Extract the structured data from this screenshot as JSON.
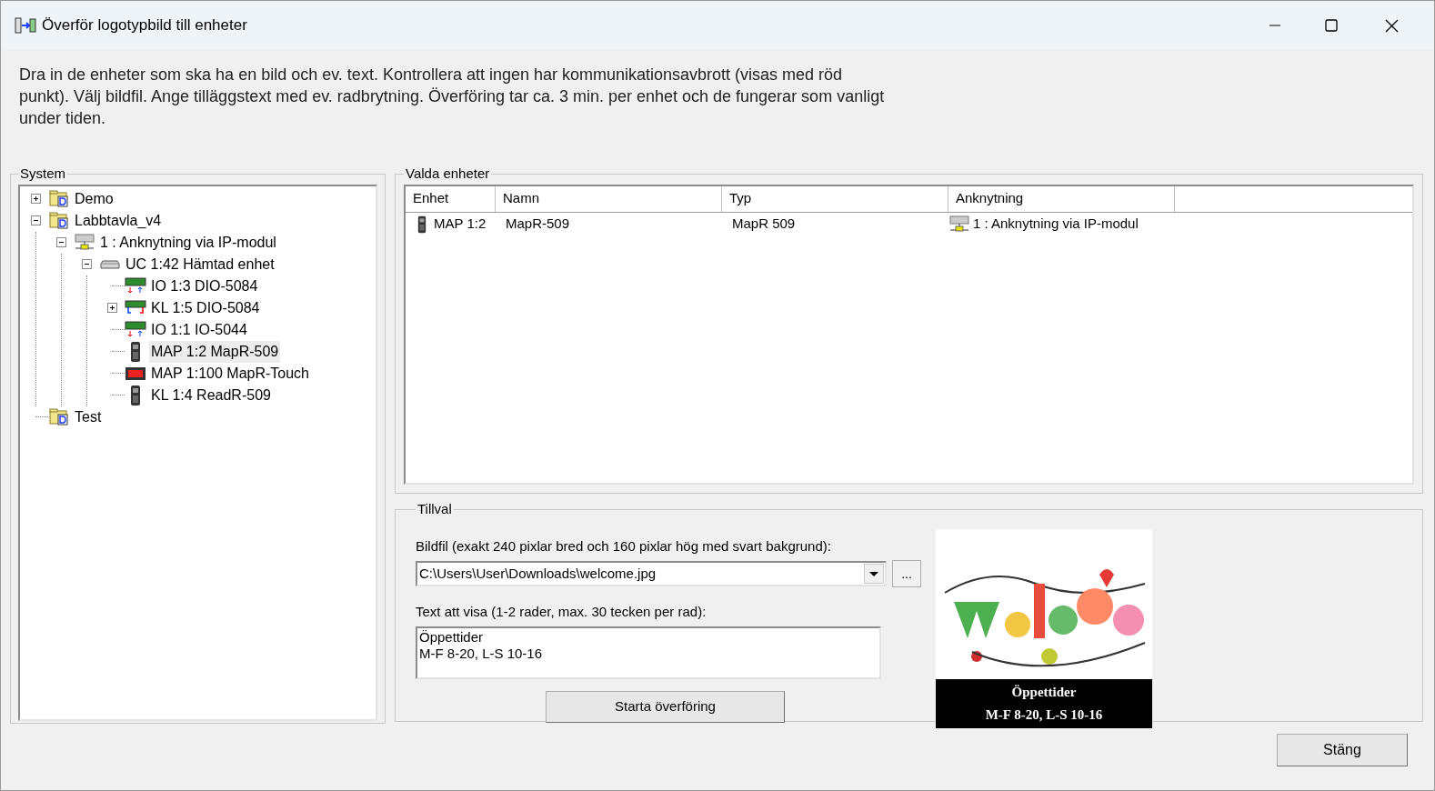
{
  "window": {
    "title": "Överför logotypbild till enheter"
  },
  "instructions": "Dra in de enheter som ska ha en bild och ev. text. Kontrollera att ingen har kommunikationsavbrott (visas med röd punkt). Välj bildfil. Ange tilläggstext med ev. radbrytning. Överföring tar ca. 3 min. per enhet och de fungerar som vanligt under tiden.",
  "system": {
    "title": "System",
    "tree": [
      {
        "label": "Demo",
        "kind": "folder",
        "expanded": false,
        "selected": false
      },
      {
        "label": "Labbtavla_v4",
        "kind": "folder",
        "expanded": true,
        "selected": false,
        "children": [
          {
            "label": "1 : Anknytning via IP-modul",
            "kind": "network",
            "expanded": true,
            "selected": false,
            "children": [
              {
                "label": "UC 1:42 Hämtad enhet",
                "kind": "controller",
                "expanded": true,
                "selected": false,
                "children": [
                  {
                    "label": "IO 1:3 DIO-5084",
                    "kind": "io",
                    "selected": false
                  },
                  {
                    "label": "KL 1:5 DIO-5084",
                    "kind": "kl",
                    "expanded": false,
                    "selected": false
                  },
                  {
                    "label": "IO 1:1 IO-5044",
                    "kind": "io",
                    "selected": false
                  },
                  {
                    "label": "MAP 1:2 MapR-509",
                    "kind": "reader",
                    "selected": true
                  },
                  {
                    "label": "MAP 1:100 MapR-Touch",
                    "kind": "touch",
                    "selected": false
                  },
                  {
                    "label": "KL 1:4 ReadR-509",
                    "kind": "reader",
                    "selected": false
                  }
                ]
              }
            ]
          }
        ]
      },
      {
        "label": "Test",
        "kind": "folder",
        "selected": false
      }
    ]
  },
  "selected_units": {
    "title": "Valda enheter",
    "table": {
      "columns": [
        "Enhet",
        "Namn",
        "Typ",
        "Anknytning"
      ],
      "rows": [
        {
          "unit": "MAP 1:2",
          "name": "MapR-509",
          "type": "MapR 509",
          "connection": "1 : Anknytning via IP-modul"
        }
      ]
    }
  },
  "options": {
    "title": "Tillval",
    "image_file": {
      "label": "Bildfil (exakt 240 pixlar bred och 160 pixlar hög med svart bakgrund):",
      "value": "C:\\Users\\User\\Downloads\\welcome.jpg",
      "browse": "..."
    },
    "text": {
      "label": "Text att visa (1-2 rader, max. 30 tecken per rad):",
      "value": "Öppettider\nM-F 8-20, L-S 10-16"
    },
    "start_button": "Starta överföring",
    "preview": {
      "kind": "picture",
      "caption": [
        "Öppettider",
        "M-F 8-20, L-S 10-16"
      ]
    }
  },
  "close_button": "Stäng"
}
